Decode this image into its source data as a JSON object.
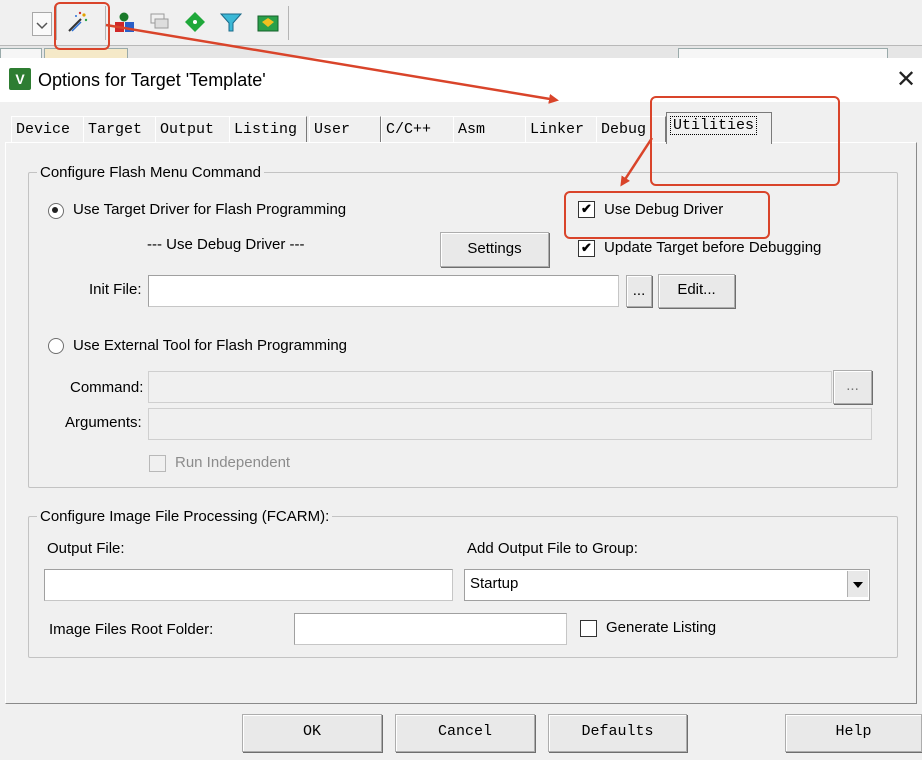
{
  "toolbar": {
    "icons": [
      "dropdown-icon",
      "magic-wand-icon",
      "team-icon",
      "stack-icon",
      "green-diamond-icon",
      "funnel-icon",
      "pack-icon"
    ]
  },
  "dialog": {
    "title": "Options for Target 'Template'",
    "close": "✕",
    "icon_letter": "V"
  },
  "tabs": [
    "Device",
    "Target",
    "Output",
    "Listing",
    "User",
    "C/C++",
    "Asm",
    "Linker",
    "Debug",
    "Utilities"
  ],
  "flash": {
    "legend": "Configure Flash Menu Command",
    "use_target_driver": "Use Target Driver for Flash Programming",
    "debug_driver_note": "--- Use Debug Driver ---",
    "settings": "Settings",
    "use_debug_driver": "Use Debug Driver",
    "update_target": "Update Target before Debugging",
    "init_file_label": "Init File:",
    "browse": "...",
    "edit": "Edit...",
    "use_external_tool": "Use External Tool for Flash Programming",
    "command_label": "Command:",
    "arguments_label": "Arguments:",
    "run_independent": "Run Independent",
    "checks": {
      "check_mark": "✔"
    }
  },
  "image": {
    "legend": "Configure Image File Processing (FCARM):",
    "output_file_label": "Output File:",
    "add_output_label": "Add Output File  to Group:",
    "group_value": "Startup",
    "root_folder_label": "Image Files Root Folder:",
    "generate_listing": "Generate Listing"
  },
  "buttons": {
    "ok": "OK",
    "cancel": "Cancel",
    "defaults": "Defaults",
    "help": "Help"
  },
  "colors": {
    "annotation": "#d9442a"
  }
}
